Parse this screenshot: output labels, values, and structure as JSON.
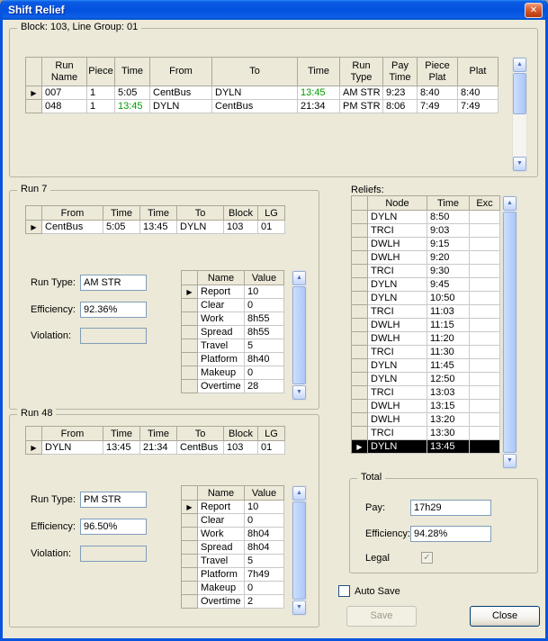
{
  "window": {
    "title": "Shift Relief"
  },
  "icons": {
    "close": "✕",
    "row_marker": "▶",
    "scroll_up": "▲",
    "scroll_down": "▼",
    "check": "✓"
  },
  "colors": {
    "titlebar_blue": "#0352E0",
    "highlight_green": "#00A000",
    "selection_bg": "#000000",
    "selection_fg": "#FFFFFF",
    "dialog_face": "#ECE9D8"
  },
  "block": {
    "label": "Block: 103, Line Group: 01",
    "headers": [
      "Run Name",
      "Piece",
      "Time",
      "From",
      "To",
      "Time",
      "Run Type",
      "Pay Time",
      "Piece Plat",
      "Plat"
    ],
    "rows": [
      {
        "run_name": "007",
        "piece": "1",
        "time1": "5:05",
        "from": "CentBus",
        "to": "DYLN",
        "time2": "13:45",
        "run_type": "AM STR",
        "pay_time": "9:23",
        "piece_plat": "8:40",
        "plat": "8:40"
      },
      {
        "run_name": "048",
        "piece": "1",
        "time1": "13:45",
        "from": "DYLN",
        "to": "CentBus",
        "time2": "21:34",
        "run_type": "PM STR",
        "pay_time": "8:06",
        "piece_plat": "7:49",
        "plat": "7:49"
      }
    ]
  },
  "run7": {
    "label": "Run 7",
    "trip_headers": [
      "From",
      "Time",
      "Time",
      "To",
      "Block",
      "LG"
    ],
    "trip": {
      "from": "CentBus",
      "time1": "5:05",
      "time2": "13:45",
      "to": "DYLN",
      "block": "103",
      "lg": "01"
    },
    "fields": {
      "run_type_label": "Run Type:",
      "run_type": "AM STR",
      "efficiency_label": "Efficiency:",
      "efficiency": "92.36%",
      "violation_label": "Violation:",
      "violation": ""
    },
    "stats_headers": [
      "Name",
      "Value"
    ],
    "stats": [
      {
        "name": "Report",
        "value": "10"
      },
      {
        "name": "Clear",
        "value": "0"
      },
      {
        "name": "Work",
        "value": "8h55"
      },
      {
        "name": "Spread",
        "value": "8h55"
      },
      {
        "name": "Travel",
        "value": "5"
      },
      {
        "name": "Platform",
        "value": "8h40"
      },
      {
        "name": "Makeup",
        "value": "0"
      },
      {
        "name": "Overtime",
        "value": "28"
      }
    ]
  },
  "run48": {
    "label": "Run 48",
    "trip_headers": [
      "From",
      "Time",
      "Time",
      "To",
      "Block",
      "LG"
    ],
    "trip": {
      "from": "DYLN",
      "time1": "13:45",
      "time2": "21:34",
      "to": "CentBus",
      "block": "103",
      "lg": "01"
    },
    "fields": {
      "run_type_label": "Run Type:",
      "run_type": "PM STR",
      "efficiency_label": "Efficiency:",
      "efficiency": "96.50%",
      "violation_label": "Violation:",
      "violation": ""
    },
    "stats_headers": [
      "Name",
      "Value"
    ],
    "stats": [
      {
        "name": "Report",
        "value": "10"
      },
      {
        "name": "Clear",
        "value": "0"
      },
      {
        "name": "Work",
        "value": "8h04"
      },
      {
        "name": "Spread",
        "value": "8h04"
      },
      {
        "name": "Travel",
        "value": "5"
      },
      {
        "name": "Platform",
        "value": "7h49"
      },
      {
        "name": "Makeup",
        "value": "0"
      },
      {
        "name": "Overtime",
        "value": "2"
      }
    ]
  },
  "reliefs": {
    "label": "Reliefs:",
    "headers": [
      "Node",
      "Time",
      "Exc"
    ],
    "selected_index": 17,
    "rows": [
      {
        "node": "DYLN",
        "time": "8:50",
        "exc": ""
      },
      {
        "node": "TRCI",
        "time": "9:03",
        "exc": ""
      },
      {
        "node": "DWLH",
        "time": "9:15",
        "exc": ""
      },
      {
        "node": "DWLH",
        "time": "9:20",
        "exc": ""
      },
      {
        "node": "TRCI",
        "time": "9:30",
        "exc": ""
      },
      {
        "node": "DYLN",
        "time": "9:45",
        "exc": ""
      },
      {
        "node": "DYLN",
        "time": "10:50",
        "exc": ""
      },
      {
        "node": "TRCI",
        "time": "11:03",
        "exc": ""
      },
      {
        "node": "DWLH",
        "time": "11:15",
        "exc": ""
      },
      {
        "node": "DWLH",
        "time": "11:20",
        "exc": ""
      },
      {
        "node": "TRCI",
        "time": "11:30",
        "exc": ""
      },
      {
        "node": "DYLN",
        "time": "11:45",
        "exc": ""
      },
      {
        "node": "DYLN",
        "time": "12:50",
        "exc": ""
      },
      {
        "node": "TRCI",
        "time": "13:03",
        "exc": ""
      },
      {
        "node": "DWLH",
        "time": "13:15",
        "exc": ""
      },
      {
        "node": "DWLH",
        "time": "13:20",
        "exc": ""
      },
      {
        "node": "TRCI",
        "time": "13:30",
        "exc": ""
      },
      {
        "node": "DYLN",
        "time": "13:45",
        "exc": ""
      }
    ]
  },
  "total": {
    "label": "Total",
    "pay_label": "Pay:",
    "pay": "17h29",
    "efficiency_label": "Efficiency:",
    "efficiency": "94.28%",
    "legal_label": "Legal",
    "legal_checked": true
  },
  "footer": {
    "auto_save_label": "Auto Save",
    "auto_save_checked": false,
    "save_label": "Save",
    "close_label": "Close"
  }
}
